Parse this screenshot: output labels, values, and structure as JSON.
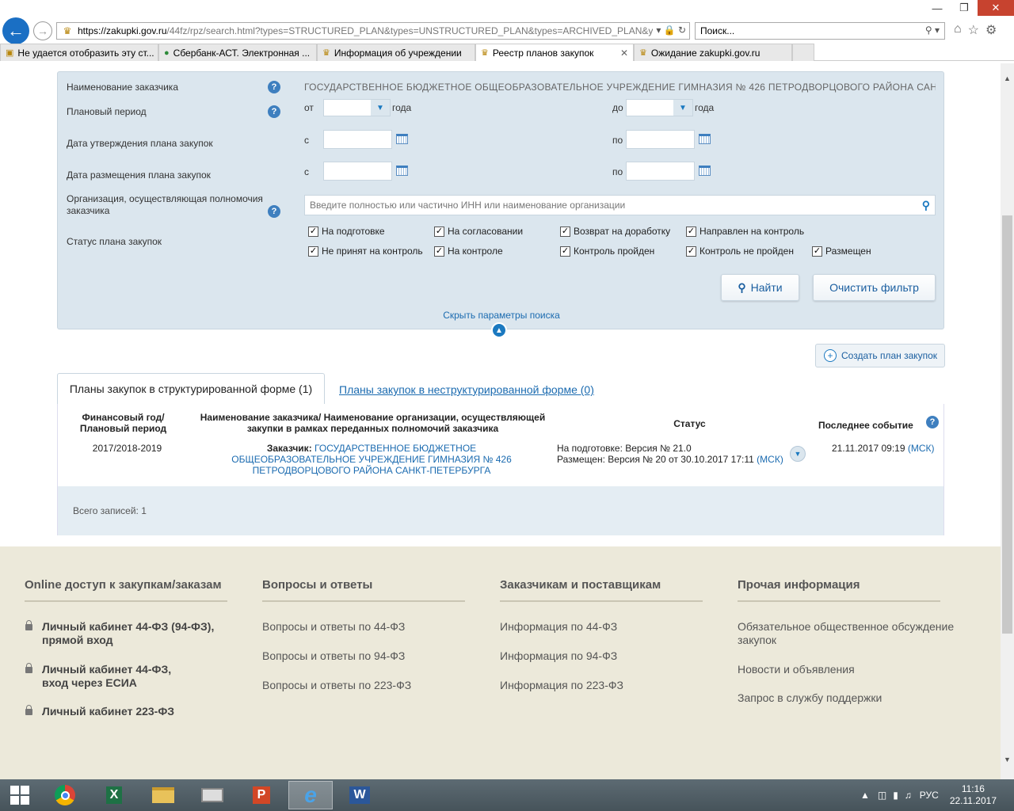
{
  "browser": {
    "url_domain": "https://zakupki.gov.ru",
    "url_path": "/44fz/rpz/search.html?types=STRUCTURED_PLAN&types=UNSTRUCTURED_PLAN&types=ARCHIVED_PLAN&year",
    "search_placeholder": "Поиск...",
    "tabs": [
      {
        "label": "Не удается отобразить эту ст..."
      },
      {
        "label": "Сбербанк-АСТ. Электронная ..."
      },
      {
        "label": "Информация об учреждении"
      },
      {
        "label": "Реестр планов закупок"
      },
      {
        "label": "Ожидание zakupki.gov.ru"
      }
    ]
  },
  "filter": {
    "customer_name_label": "Наименование заказчика",
    "customer_name_value": "ГОСУДАРСТВЕННОЕ БЮДЖЕТНОЕ ОБЩЕОБРАЗОВАТЕЛЬНОЕ УЧРЕЖДЕНИЕ ГИМНАЗИЯ № 426 ПЕТРОДВОРЦОВОГО РАЙОНА САНКТ",
    "period_label": "Плановый период",
    "from_label": "от",
    "to_label": "до",
    "year_label": "года",
    "approval_date_label": "Дата утверждения плана закупок",
    "placement_date_label": "Дата размещения плана закупок",
    "date_from_label": "с",
    "date_to_label": "по",
    "org_label": "Организация, осуществляющая полномочия заказчика",
    "org_placeholder": "Введите полностью или частично ИНН или наименование организации",
    "status_label": "Статус плана закупок",
    "statuses": [
      {
        "label": "На подготовке"
      },
      {
        "label": "На согласовании"
      },
      {
        "label": "Возврат на доработку"
      },
      {
        "label": "Направлен на контроль"
      },
      {
        "label": "Не принят на контроль"
      },
      {
        "label": "На контроле"
      },
      {
        "label": "Контроль пройден"
      },
      {
        "label": "Контроль не пройден"
      },
      {
        "label": "Размещен"
      }
    ],
    "find_button": "Найти",
    "clear_button": "Очистить фильтр",
    "hide_params": "Скрыть параметры поиска"
  },
  "create_plan": "Создать план закупок",
  "result_tabs": {
    "structured": "Планы закупок в структурированной форме (1)",
    "unstructured": "Планы закупок в неструктурированной форме (0)"
  },
  "table": {
    "col_year": "Финансовый год/ Плановый период",
    "col_name": "Наименование заказчика/ Наименование организации, осуществляющей закупки в рамках переданных полномочий заказчика",
    "col_status": "Статус",
    "col_event": "Последнее событие",
    "row": {
      "year": "2017/2018-2019",
      "customer_prefix": "Заказчик:",
      "customer_name": "ГОСУДАРСТВЕННОЕ БЮДЖЕТНОЕ ОБЩЕОБРАЗОВАТЕЛЬНОЕ УЧРЕЖДЕНИЕ ГИМНАЗИЯ № 426 ПЕТРОДВОРЦОВОГО РАЙОНА САНКТ-ПЕТЕРБУРГА",
      "status_line1": "На подготовке: Версия № 21.0",
      "status_line2": "Размещен: Версия № 20 от 30.10.2017 17:11",
      "tz": "(МСК)",
      "event": "21.11.2017 09:19"
    },
    "total": "Всего записей: 1"
  },
  "footer": {
    "col1": {
      "title": "Online доступ к закупкам/заказам",
      "items": [
        "Личный кабинет 44-ФЗ (94-ФЗ),",
        "прямой вход",
        "Личный кабинет 44-ФЗ,",
        "вход через ЕСИА",
        "Личный кабинет 223-ФЗ"
      ]
    },
    "col2": {
      "title": "Вопросы и ответы",
      "items": [
        "Вопросы и ответы по 44-ФЗ",
        "Вопросы и ответы по 94-ФЗ",
        "Вопросы и ответы по 223-ФЗ"
      ]
    },
    "col3": {
      "title": "Заказчикам и поставщикам",
      "items": [
        "Информация по 44-ФЗ",
        "Информация по 94-ФЗ",
        "Информация по 223-ФЗ"
      ]
    },
    "col4": {
      "title": "Прочая информация",
      "items": [
        "Обязательное общественное обсуждение",
        "закупок",
        "Новости и объявления",
        "Запрос в службу поддержки"
      ]
    }
  },
  "taskbar": {
    "lang": "РУС",
    "time": "11:16",
    "date": "22.11.2017"
  }
}
